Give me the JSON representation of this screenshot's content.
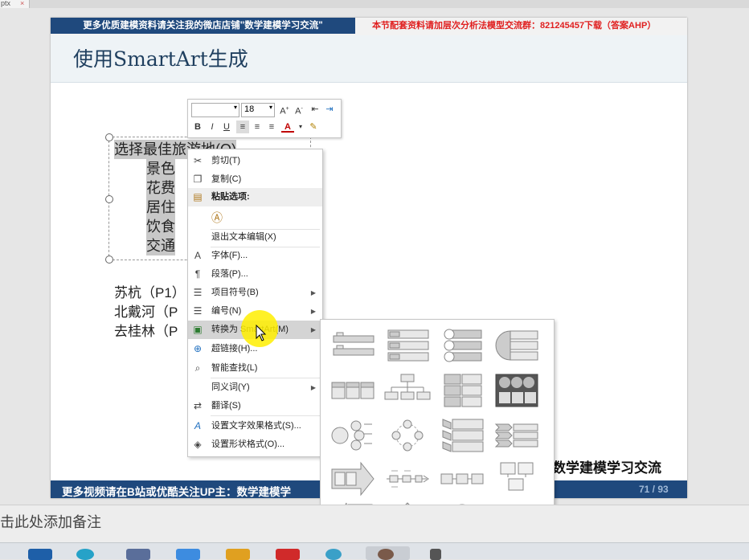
{
  "app": {
    "file_tab_label": "ptx",
    "file_tab_close": "×"
  },
  "slide": {
    "banner_left": "更多优质建模资料请关注我的微店店铺\"数学建模学习交流\"",
    "banner_right": "本节配套资料请加层次分析法模型交流群：821245457下载（答案AHP）",
    "title": "使用SmartArt生成",
    "textbox_lines": [
      "选择最佳旅游地(O)",
      "景色",
      "花费",
      "居住",
      "饮食",
      "交通"
    ],
    "body_lines": [
      "苏杭（P1）",
      "北戴河（P",
      "去桂林（P"
    ],
    "brand_text": "数学建模学习交流",
    "footer_text": "更多视频请在B站或优酷关注UP主：数学建模学",
    "page_number": "71 / 93"
  },
  "minibar": {
    "font_name": "",
    "font_size": "18",
    "buttons": [
      "B",
      "I",
      "U"
    ]
  },
  "context_menu": {
    "items": [
      {
        "icon": "cut-icon",
        "label": "剪切(T)"
      },
      {
        "icon": "copy-icon",
        "label": "复制(C)"
      },
      {
        "icon": "paste-icon",
        "label": "粘贴选项:"
      },
      {
        "icon": "paste-text-icon",
        "label": ""
      },
      {
        "icon": "",
        "label": "退出文本编辑(X)"
      },
      {
        "icon": "font-icon",
        "label": "字体(F)..."
      },
      {
        "icon": "paragraph-icon",
        "label": "段落(P)..."
      },
      {
        "icon": "bullets-icon",
        "label": "项目符号(B)"
      },
      {
        "icon": "numbering-icon",
        "label": "编号(N)"
      },
      {
        "icon": "smartart-icon",
        "label": "转换为 SmartArt(M)"
      },
      {
        "icon": "hyperlink-icon",
        "label": "超链接(H)..."
      },
      {
        "icon": "smart-lookup-icon",
        "label": "智能查找(L)"
      },
      {
        "icon": "",
        "label": "同义词(Y)"
      },
      {
        "icon": "translate-icon",
        "label": "翻译(S)"
      },
      {
        "icon": "text-effects-icon",
        "label": "设置文字效果格式(S)..."
      },
      {
        "icon": "shape-format-icon",
        "label": "设置形状格式(O)..."
      }
    ]
  },
  "notes": {
    "placeholder": "击此处添加备注"
  }
}
